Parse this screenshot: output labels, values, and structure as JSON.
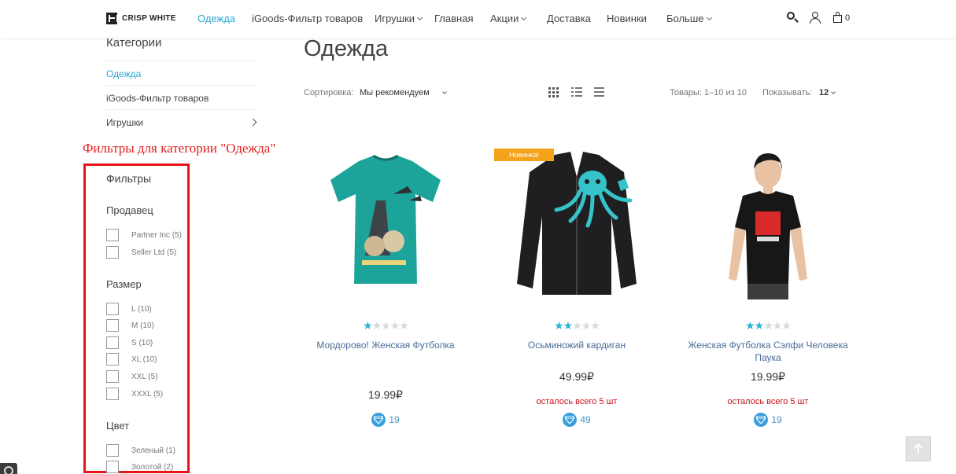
{
  "header": {
    "logo_text": "CRISP WHITE",
    "nav": [
      {
        "label": "Одежда",
        "active": true
      },
      {
        "label": "iGoods-Фильтр товаров"
      },
      {
        "label": "Игрушки",
        "dropdown": true
      },
      {
        "label": "Главная"
      },
      {
        "label": "Акции",
        "dropdown": true
      },
      {
        "label": "Доставка"
      },
      {
        "label": "Новинки"
      },
      {
        "label": "Больше",
        "dropdown": true
      }
    ],
    "cart_count": "0",
    "icons": [
      "search-icon",
      "user-icon",
      "shopping-bag-icon"
    ]
  },
  "sidebar": {
    "categories_title": "Категории",
    "categories": [
      {
        "label": "Одежда",
        "active": true
      },
      {
        "label": "iGoods-Фильтр товаров"
      },
      {
        "label": "Игрушки",
        "has_children": true
      }
    ],
    "annotation": "Фильтры для категории \"Одежда\"",
    "filters_title": "Фильтры",
    "filter_groups": [
      {
        "title": "Продавец",
        "options": [
          "Partner Inc (5)",
          "Seller Ltd (5)"
        ]
      },
      {
        "title": "Размер",
        "options": [
          "L (10)",
          "M (10)",
          "S (10)",
          "XL (10)",
          "XXL (5)",
          "XXXL (5)"
        ]
      },
      {
        "title": "Цвет",
        "options": [
          "Зеленый (1)",
          "Золотой (2)"
        ]
      }
    ]
  },
  "main": {
    "title": "Одежда",
    "sort_label": "Сортировка:",
    "sort_value": "Мы рекомендуем",
    "count_text": "Товары: 1–10 из 10",
    "show_label": "Показывать:",
    "show_value": "12",
    "products": [
      {
        "name": "Мордорово! Женская Футболка",
        "price": "19.99₽",
        "stock": "",
        "points": "19",
        "rating": 1,
        "badge": ""
      },
      {
        "name": "Осьминожий кардиган",
        "price": "49.99₽",
        "stock": "осталось всего 5 шт",
        "points": "49",
        "rating": 2,
        "badge": "Новинка!"
      },
      {
        "name": "Женская Футболка Сэлфи Человека Паука",
        "price": "19.99₽",
        "stock": "осталось всего 5 шт",
        "points": "19",
        "rating": 2,
        "badge": ""
      }
    ]
  },
  "colors": {
    "accent": "#29a7d1",
    "annotation_red": "#e8141a",
    "badge": "#f3a21a",
    "stock_red": "#c6111b"
  }
}
